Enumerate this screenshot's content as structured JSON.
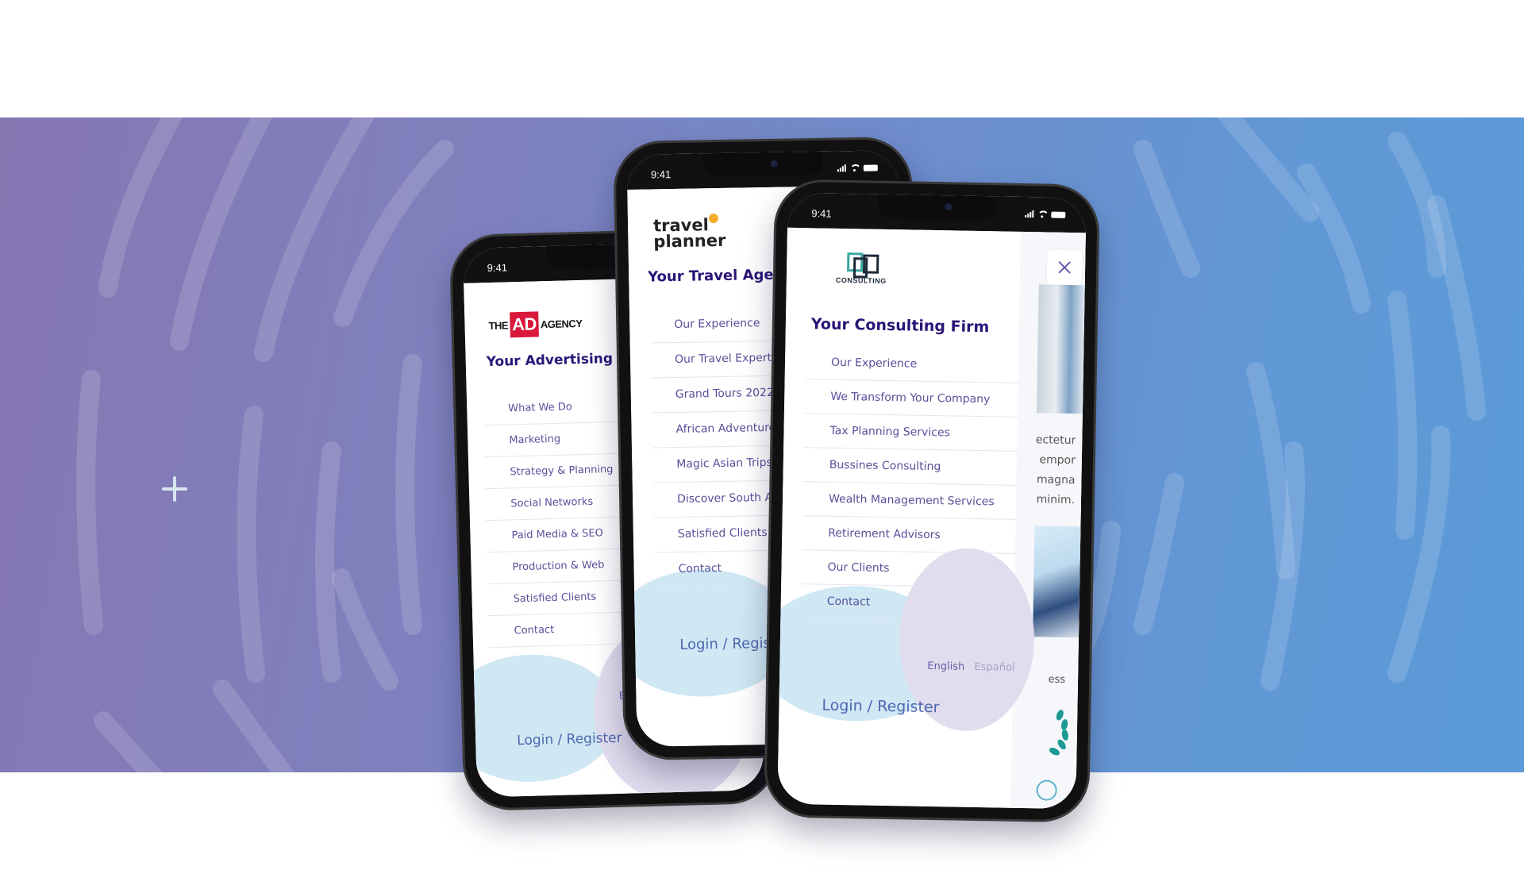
{
  "page": {
    "background_gradient": [
      "#8677b3",
      "#5c9ad8"
    ],
    "accent": "#2a1577",
    "menu_color": "#58509a"
  },
  "decor": {
    "plus_icon": "plus-icon"
  },
  "phones": [
    {
      "status_time": "9:41",
      "logo": {
        "prefix": "THE",
        "highlight": "AD",
        "suffix": "AGENCY"
      },
      "heading": "Your Advertising Agency",
      "menu": [
        "What We Do",
        "Marketing",
        "Strategy & Planning",
        "Social Networks",
        "Paid Media & SEO",
        "Production & Web",
        "Satisfied Clients",
        "Contact"
      ],
      "lang": {
        "english": "English"
      },
      "login": "Login / Register"
    },
    {
      "status_time": "9:41",
      "logo": {
        "line1": "travel",
        "line2": "planner"
      },
      "heading": "Your Travel Agency",
      "menu": [
        "Our Experience",
        "Our Travel Experts",
        "Grand Tours 2022",
        "African Adventure",
        "Magic Asian Trips",
        "Discover South America",
        "Satisfied Clients",
        "Contact"
      ],
      "login": "Login / Register"
    },
    {
      "status_time": "9:41",
      "logo": {
        "label": "CONSULTING"
      },
      "heading": "Your Consulting Firm",
      "menu": [
        "Our Experience",
        "We Transform Your Company",
        "Tax Planning Services",
        "Bussines Consulting",
        "Wealth Management Services",
        "Retirement Advisors",
        "Our Clients",
        "Contact"
      ],
      "lang": {
        "english": "English",
        "spanish": "Español"
      },
      "login": "Login / Register",
      "background_text": [
        "ectetur",
        "empor",
        "magna",
        "minim."
      ],
      "background_text_2": "ess"
    }
  ]
}
